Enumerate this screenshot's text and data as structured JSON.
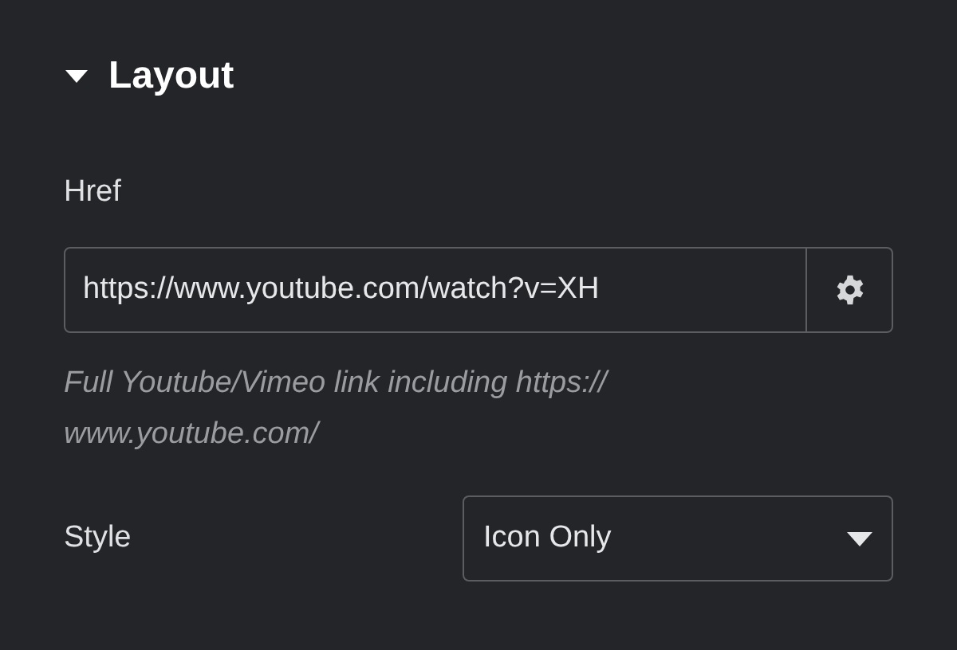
{
  "section": {
    "title": "Layout",
    "expanded": true
  },
  "href": {
    "label": "Href",
    "value": "https://www.youtube.com/watch?v=XH",
    "description": "Full Youtube/Vimeo link including https:// www.youtube.com/"
  },
  "style": {
    "label": "Style",
    "value": "Icon Only"
  }
}
